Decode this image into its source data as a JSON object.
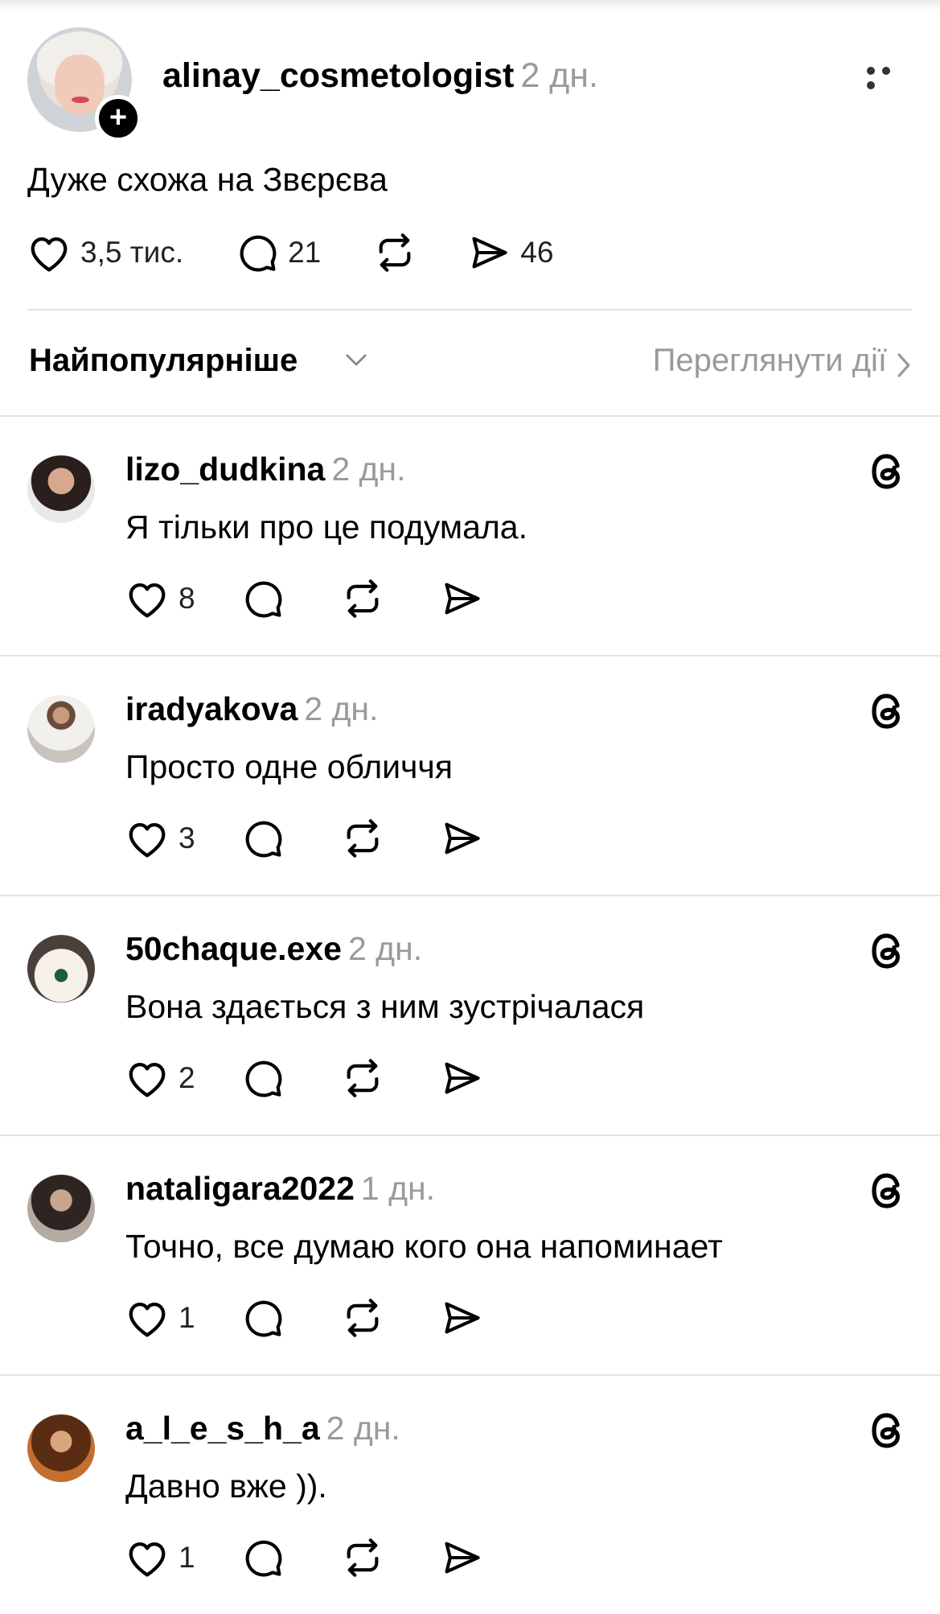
{
  "post": {
    "author": "alinay_cosmetologist",
    "time": "2 дн.",
    "text": "Дуже схожа на Звєрєва",
    "likes": "3,5 тис.",
    "replies": "21",
    "shares": "46",
    "follow_symbol": "+"
  },
  "sort": {
    "label": "Найпопулярніше",
    "view_activity": "Переглянути дії"
  },
  "comments": [
    {
      "username": "lizo_dudkina",
      "time": "2 дн.",
      "text": "Я тільки про це подумала.",
      "likes": "8"
    },
    {
      "username": "iradyakova",
      "time": "2 дн.",
      "text": "Просто одне обличчя",
      "likes": "3"
    },
    {
      "username": "50chaque.exe",
      "time": "2 дн.",
      "text": "Вона здається з ним зустрічалася",
      "likes": "2"
    },
    {
      "username": "nataligara2022",
      "time": "1 дн.",
      "text": "Точно, все думаю кого она напоминает",
      "likes": "1"
    },
    {
      "username": "a_l_e_s_h_a",
      "time": "2 дн.",
      "text": "Давно вже )).",
      "likes": "1"
    }
  ],
  "icons": {
    "like": "heart-icon",
    "reply": "speech-bubble-icon",
    "repost": "repost-arrows-icon",
    "share": "paper-plane-icon",
    "threads": "threads-logo-icon",
    "more": "ellipsis-icon",
    "chevron_down": "chevron-down-icon",
    "chevron_right": "chevron-right-icon"
  },
  "colors": {
    "text": "#000000",
    "secondary_text": "#9a9a9a",
    "divider": "#e3e3e3"
  }
}
